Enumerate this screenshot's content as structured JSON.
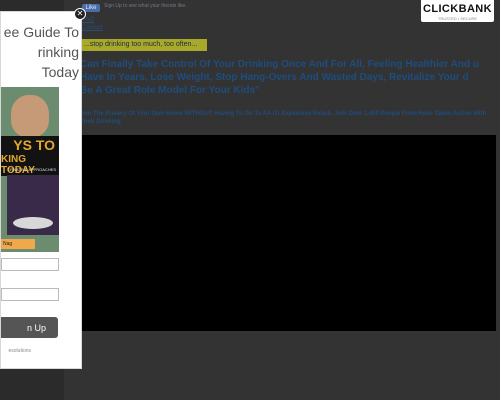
{
  "social": {
    "like_label": "Like",
    "like_text": "Sign Up to see what your friends like."
  },
  "clickbank": {
    "logo": "CLICKBANK",
    "tagline": "TRUSTED • SECURE"
  },
  "nav": {
    "links": [
      "FAQ",
      "Contact"
    ]
  },
  "highlight": {
    "text": "...stop drinking too much, too often..."
  },
  "headline": "Can Finally Take Control Of Your Drinking Once And For All, Feeling Healthier And u Have In Years, Lose Weight, Stop Hang-Overs And Wasted Days, Revitalize Your d Be A Great Role Model For Your Kids\"",
  "subheadline": "rom The Privacy Of Your Own Home WITHOUT Having To Go To AA Or Expensive Rehab. Join Over 1,400 People From Have Taken Action With Their Drinking",
  "modal": {
    "title": "ee Guide To\nrinking Today",
    "book": {
      "line1": "YS TO",
      "line2": "KING TODAY",
      "line3": "ERNATIVE APPROACHES",
      "tag": "Nag"
    },
    "signup_label": "n Up",
    "footer": "esolutions"
  },
  "colors": {
    "headline": "#1e4d7e",
    "highlight_bg": "#a8a82a",
    "overlay": "#333333"
  }
}
